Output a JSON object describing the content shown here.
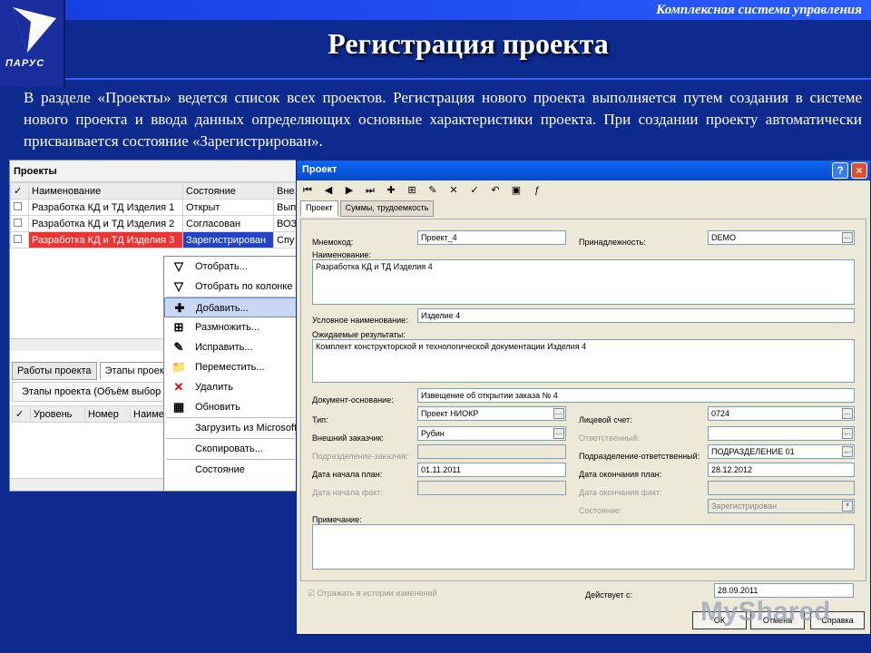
{
  "header": {
    "top_text": "Комплексная система управления",
    "title": "Регистрация проекта",
    "logo_text": "ПАРУС"
  },
  "intro": "В разделе «Проекты» ведется список всех проектов. Регистрация нового проекта выполняется путем создания в системе нового проекта и ввода данных определяющих основные характеристики проекта. При создании проекту автоматически присваивается состояние «Зарегистрирован».",
  "projects": {
    "title": "Проекты",
    "columns": [
      "Наименование",
      "Состояние",
      "Вне"
    ],
    "rows": [
      {
        "name": "Разработка КД и ТД Изделия 1",
        "state": "Открыт",
        "ext": "Вып"
      },
      {
        "name": "Разработка КД и ТД Изделия 2",
        "state": "Согласован",
        "ext": "ВОЗ"
      },
      {
        "name": "Разработка КД и ТД Изделия 3",
        "state": "Зарегистрирован",
        "ext": "Спу"
      }
    ],
    "tabs": [
      "Работы проекта",
      "Этапы проект"
    ],
    "stages_title": "Этапы проекта (Объём выбор",
    "stage_columns": [
      "Уровень",
      "Номер",
      "Наиме"
    ]
  },
  "menu": {
    "items": [
      "Отобрать...",
      "Отобрать по колонке",
      "Добавить...",
      "Размножить...",
      "Исправить...",
      "Переместить...",
      "Удалить",
      "Обновить",
      "Загрузить из Microsoft",
      "Скопировать...",
      "Состояние"
    ]
  },
  "dialog": {
    "title": "Проект",
    "tabs": [
      "Проект",
      "Суммы, трудоемкость"
    ],
    "labels": {
      "mnemo": "Мнемокод:",
      "belong": "Принадлежность:",
      "name": "Наименование:",
      "cond": "Условное наименование:",
      "expected": "Ожидаемые результаты:",
      "doc": "Документ-основание:",
      "type": "Тип:",
      "account": "Лицевой счет:",
      "customer": "Внешний заказчик:",
      "resp": "Ответственный:",
      "cust_dept": "Подразделение-заказчик:",
      "resp_dept": "Подразделение-ответственный:",
      "start_plan": "Дата начала план:",
      "end_plan": "Дата окончания план:",
      "start_fact": "Дата начала факт:",
      "end_fact": "Дата окончания факт:",
      "state": "Состояние:",
      "note": "Примечание:",
      "history": "Отражать в истории изменений",
      "valid_from": "Действует с:"
    },
    "values": {
      "mnemo": "Проект_4",
      "belong": "DEMO",
      "name": "Разработка КД и ТД Изделия 4",
      "cond": "Изделие 4",
      "expected": "Комплект конструкторской и технологической документации Изделия 4",
      "doc": "Извещение об открытии заказа № 4",
      "type": "Проект НИОКР",
      "account": "0724",
      "customer": "Рубин",
      "resp_dept": "ПОДРАЗДЕЛЕНИЕ 01",
      "start_plan": "01.11.2011",
      "end_plan": "28.12.2012",
      "state": "Зарегистрирован",
      "valid_from": "28.09.2011"
    },
    "buttons": {
      "ok": "ОК",
      "cancel": "Отмена",
      "help": "Справка"
    }
  },
  "watermark": "MyShared"
}
